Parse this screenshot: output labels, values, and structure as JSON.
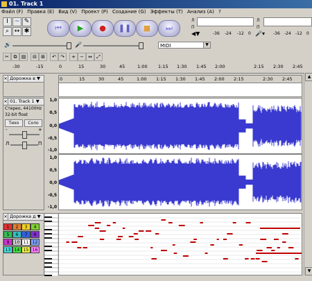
{
  "window": {
    "title": "01. Track 1"
  },
  "menu": [
    "Файл (F)",
    "Правка (E)",
    "Вид (V)",
    "Проект (P)",
    "Создание (G)",
    "Эффекты (T)",
    "Анализ (A)",
    "?"
  ],
  "meter_scale": [
    "-36",
    "-24",
    "-12",
    "0"
  ],
  "meter_channel_labels": [
    "Л",
    "П",
    "Л",
    "П"
  ],
  "midi_device": {
    "selected": "MIDI"
  },
  "ruler_ticks": [
    "-30",
    "-15",
    "0",
    "15",
    "30",
    "45",
    "1:00",
    "1:15",
    "1:30",
    "1:45",
    "2:00",
    "2:15",
    "2:30",
    "2:45"
  ],
  "timeline_ticks": [
    "0",
    "15",
    "30",
    "45",
    "1:00",
    "1:15",
    "1:30",
    "1:45",
    "2:00",
    "2:15",
    "2:30",
    "2:45"
  ],
  "label_track": {
    "name": "Дорожка в"
  },
  "audio_track": {
    "name": "01. Track 1",
    "info_line1": "Стерео, 44100Hz",
    "info_line2": "32-bit float",
    "mute_label": "Тихо",
    "solo_label": "Соло",
    "gain_minus": "-",
    "gain_plus": "+",
    "pan_left": "Л",
    "pan_right": "П",
    "scale": [
      "1,0",
      "0,5",
      "0,0",
      "-0,5",
      "-1,0"
    ]
  },
  "note_track": {
    "name": "Дорожка д",
    "channels": [
      "1",
      "2",
      "3",
      "4",
      "5",
      "6",
      "7",
      "8",
      "9",
      "10",
      "11",
      "12",
      "13",
      "14",
      "15",
      "16"
    ]
  },
  "colors": {
    "waveform": "#3a3ad0",
    "note": "#c00000",
    "ch": [
      "#e03030",
      "#e08030",
      "#f0d020",
      "#80d030",
      "#30c050",
      "#30c0c0",
      "#3060e0",
      "#8030d0",
      "#d030d0",
      "#d0d0d0",
      "#ffffff",
      "#80a0ff",
      "#40e0e0",
      "#40e040",
      "#f0f040",
      "#ff80ff"
    ]
  }
}
